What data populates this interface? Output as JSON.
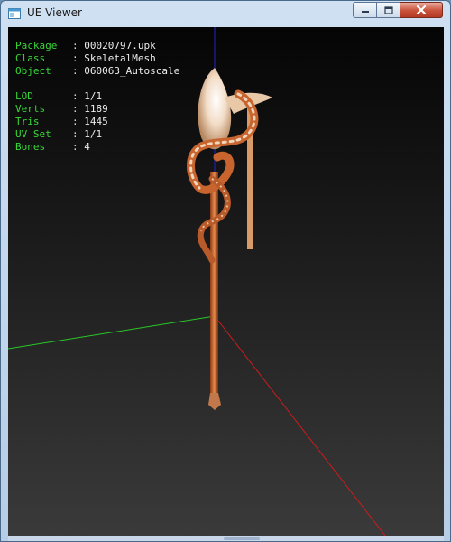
{
  "window": {
    "title": "UE Viewer",
    "controls": {
      "minimize": "minimize",
      "maximize": "maximize",
      "close": "close"
    }
  },
  "info": {
    "package": {
      "label": "Package",
      "value": "00020797.upk"
    },
    "class": {
      "label": "Class",
      "value": "SkeletalMesh"
    },
    "object": {
      "label": "Object",
      "value": "060063_Autoscale"
    },
    "lod": {
      "label": "LOD",
      "value": "1/1"
    },
    "verts": {
      "label": "Verts",
      "value": "1189"
    },
    "tris": {
      "label": "Tris",
      "value": "1445"
    },
    "uvset": {
      "label": "UV Set",
      "value": "1/1"
    },
    "bones": {
      "label": "Bones",
      "value": "4"
    },
    "separator": ":"
  },
  "axes": {
    "x_color": "#cc1c1c",
    "y_color": "#28c828",
    "z_color": "#2222cc"
  },
  "colors": {
    "label": "#38d638",
    "value": "#ececec",
    "mesh_main": "#c8652e",
    "mesh_light": "#f0d6bc"
  }
}
